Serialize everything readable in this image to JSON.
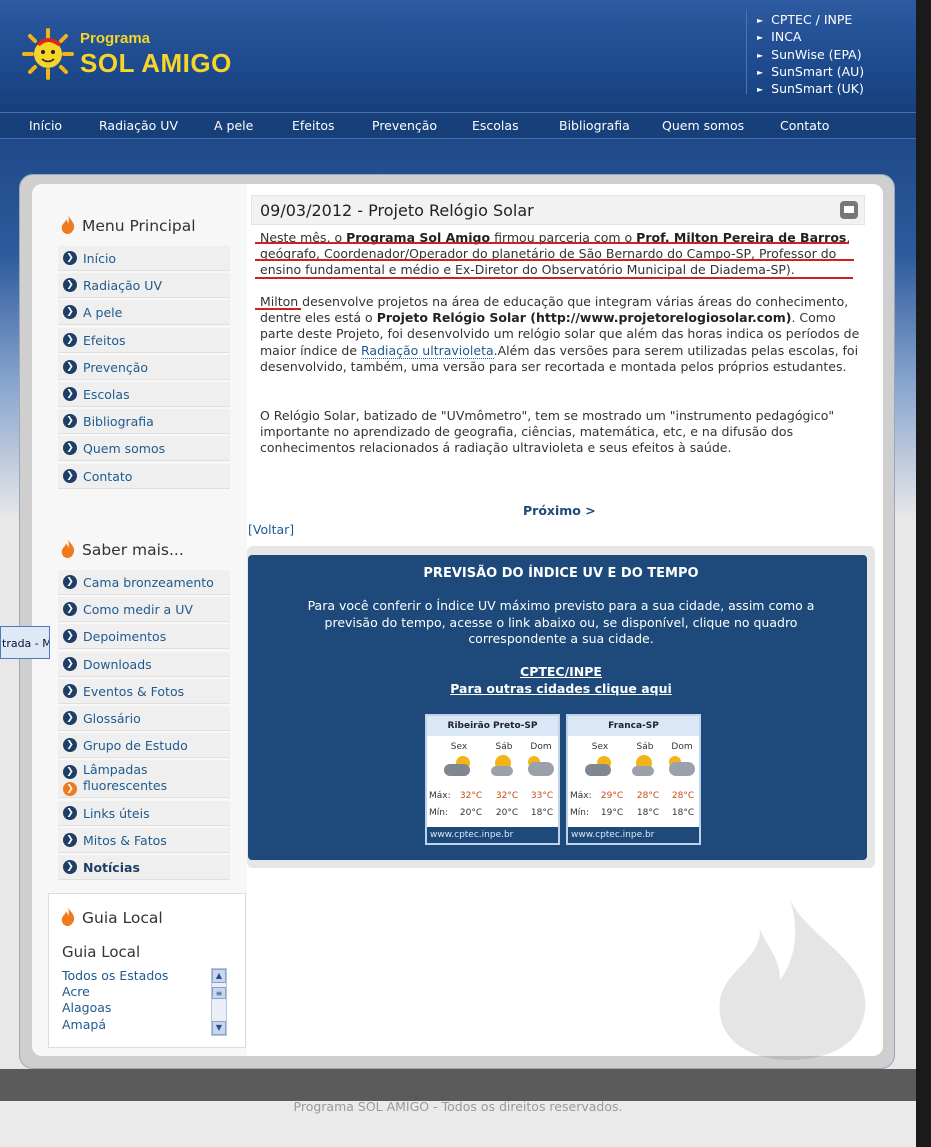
{
  "brand": {
    "prefix": "Programa",
    "name": "SOL AMIGO"
  },
  "external_links": [
    "CPTEC / INPE",
    "INCA",
    "SunWise (EPA)",
    "SunSmart (AU)",
    "SunSmart (UK)"
  ],
  "topnav": [
    "Início",
    "Radiação UV",
    "A pele",
    "Efeitos",
    "Prevenção",
    "Escolas",
    "Bibliografia",
    "Quem somos",
    "Contato"
  ],
  "sidebar": {
    "menu_title": "Menu Principal",
    "menu_items": [
      "Início",
      "Radiação UV",
      "A pele",
      "Efeitos",
      "Prevenção",
      "Escolas",
      "Bibliografia",
      "Quem somos",
      "Contato"
    ],
    "saber_title": "Saber mais...",
    "saber_items": [
      "Cama bronzeamento",
      "Como medir a UV",
      "Depoimentos",
      "Downloads",
      "Eventos & Fotos",
      "Glossário",
      "Grupo de Estudo",
      "Lâmpadas fluorescentes",
      "Links úteis",
      "Mitos & Fatos",
      "Notícias"
    ],
    "guia_title": "Guia Local",
    "guia_heading": "Guia Local",
    "guia_items": [
      "Todos os Estados",
      "Acre",
      "Alagoas",
      "Amapá"
    ]
  },
  "taskbar_popup": "trada - Mi...",
  "article": {
    "title": "09/03/2012 - Projeto Relógio Solar",
    "p1": {
      "a": "Neste mês, o ",
      "b": "Programa Sol Amigo",
      "c": " firmou parceria com o ",
      "d": "Prof. Milton Pereira de Barros",
      "e": ", geógrafo, Coordenador/Operador do planetário de São Bernardo do Campo-SP, Professor do ensino fundamental e médio e Ex-Diretor do Observatório Municipal de Diadema-SP)."
    },
    "p2": {
      "a": "Milton",
      "b": " desenvolve projetos na área de educação que integram várias áreas do conhecimento, dentre eles está o ",
      "c": "Projeto Relógio Solar (http://www.projetorelogiosolar.com)",
      "d": ". Como parte deste Projeto, foi desenvolvido um relógio solar que além das horas indica os períodos de maior índice de ",
      "e": "Radiação ultravioleta",
      "f": ".Além das versões para serem utilizadas pelas escolas, foi desenvolvido, também, uma versão para ser recortada e montada pelos próprios estudantes."
    },
    "p3": "O Relógio Solar, batizado de \"UVmômetro\", tem se mostrado um \"instrumento pedagógico\" importante no aprendizado de geografia, ciências, matemática, etc, e na difusão dos conhecimentos relacionados á radiação ultravioleta e seus efeitos à saúde.",
    "next": "Próximo >",
    "back": "[Voltar]"
  },
  "uv_box": {
    "title": "PREVISÃO DO ÍNDICE UV E DO TEMPO",
    "text": "Para você conferir o Índice UV máximo previsto para a sua cidade, assim como a previsão do tempo, acesse o link abaixo ou, se disponível, clique no quadro correspondente a sua cidade.",
    "link1": " CPTEC/INPE",
    "link2": "Para outras cidades clique aqui",
    "cards": [
      {
        "city": "Ribeirão Preto-SP",
        "days": [
          "Sex",
          "Sáb",
          "Dom"
        ],
        "max_label": "Máx:",
        "min_label": "Mín:",
        "max": [
          "32°C",
          "32°C",
          "33°C"
        ],
        "min": [
          "20°C",
          "20°C",
          "18°C"
        ],
        "footer": "www.cptec.inpe.br"
      },
      {
        "city": "Franca-SP",
        "days": [
          "Sex",
          "Sáb",
          "Dom"
        ],
        "max_label": "Máx:",
        "min_label": "Mín:",
        "max": [
          "29°C",
          "28°C",
          "28°C"
        ],
        "min": [
          "19°C",
          "18°C",
          "18°C"
        ],
        "footer": "www.cptec.inpe.br"
      }
    ]
  },
  "footer": "Programa SOL AMIGO - Todos os direitos reservados.",
  "colors": {
    "header": "#1d4a8e",
    "nav": "#173f7a",
    "link": "#1f5a8f",
    "uv_box": "#1d4a7a",
    "accent": "#f07a1c"
  }
}
